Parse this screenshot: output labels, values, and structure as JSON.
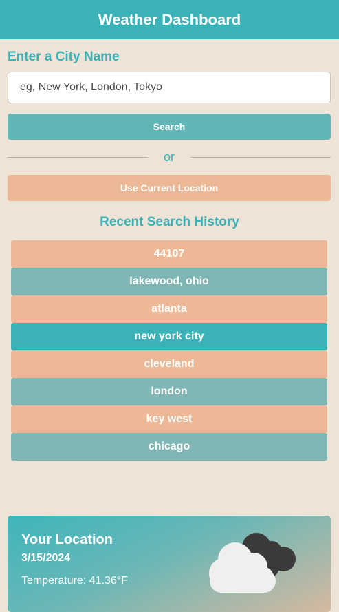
{
  "header": {
    "title": "Weather Dashboard"
  },
  "search": {
    "label": "Enter a City Name",
    "placeholder": "eg, New York, London, Tokyo",
    "search_button": "Search",
    "divider_text": "or",
    "location_button": "Use Current Location"
  },
  "history": {
    "title": "Recent Search History",
    "items": [
      {
        "label": "44107",
        "color": "#ecb896"
      },
      {
        "label": "lakewood, ohio",
        "color": "#80b7b5"
      },
      {
        "label": "atlanta",
        "color": "#ecb896"
      },
      {
        "label": "new york city",
        "color": "#3bb1b8"
      },
      {
        "label": "cleveland",
        "color": "#ecb896"
      },
      {
        "label": "london",
        "color": "#80b7b5"
      },
      {
        "label": "key west",
        "color": "#ecb896"
      },
      {
        "label": "chicago",
        "color": "#80b7b5"
      }
    ]
  },
  "weather": {
    "location": "Your Location",
    "date": "3/15/2024",
    "temperature": "Temperature: 41.36°F",
    "icon": "cloudy-icon"
  },
  "colors": {
    "accent": "#3bb1b8",
    "background": "#ede3d6",
    "search_button": "#5fb6b4",
    "location_button": "#ecb896"
  }
}
